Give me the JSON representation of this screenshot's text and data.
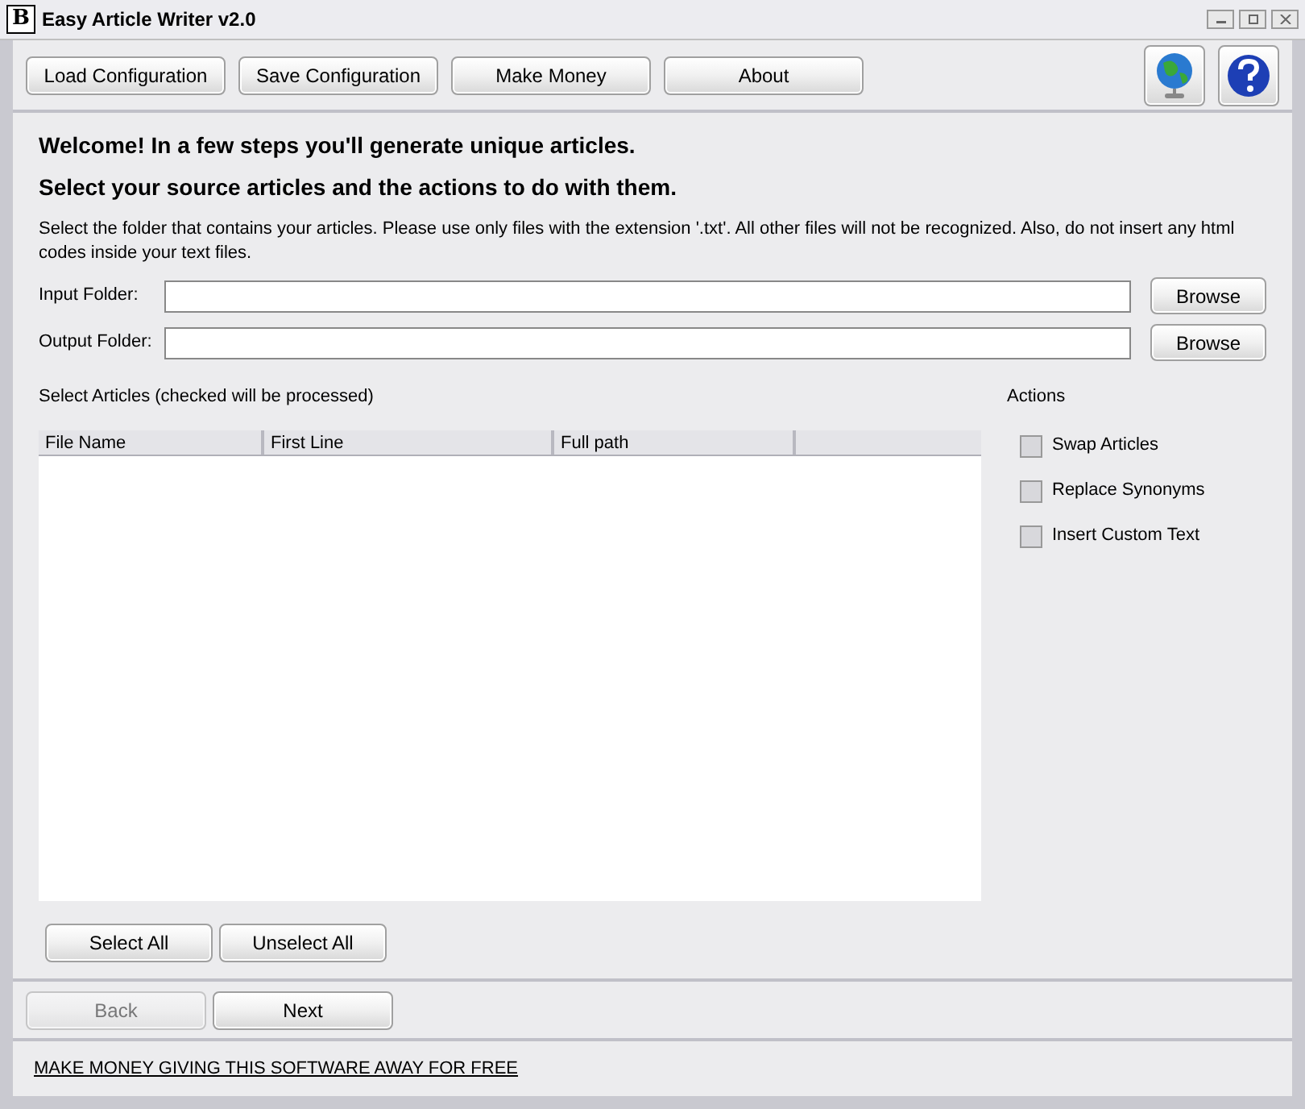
{
  "window": {
    "title": "Easy Article Writer v2.0",
    "logo": "B"
  },
  "toolbar": {
    "buttons": [
      "Load Configuration",
      "Save Configuration",
      "Make Money",
      "About"
    ]
  },
  "heading": "Welcome! In a few steps you'll generate unique articles.",
  "subheading": "Select your source articles and the actions to do with them.",
  "instructions": "Select the folder that contains your articles. Please use only files with the extension '.txt'. All other files will not be recognized. Also, do not insert any html codes inside your text files.",
  "folders": [
    {
      "label": "Input Folder:",
      "button": "Browse"
    },
    {
      "label": "Output Folder:",
      "button": "Browse"
    }
  ],
  "articles": {
    "title": "Select Articles (checked will be processed)",
    "columns": [
      "File Name",
      "First Line",
      "Full path"
    ]
  },
  "actions": {
    "title": "Actions",
    "items": [
      {
        "label": "Swap Articles",
        "checked": false
      },
      {
        "label": "Replace Synonyms",
        "checked": false
      },
      {
        "label": "Insert Custom Text",
        "checked": false
      }
    ]
  },
  "selection_buttons": [
    "Select All",
    "Unselect All"
  ],
  "nav": [
    {
      "label": "Back",
      "disabled": true
    },
    {
      "label": "Next",
      "disabled": false
    }
  ],
  "footer_link": "MAKE MONEY GIVING THIS SOFTWARE AWAY FOR FREE"
}
